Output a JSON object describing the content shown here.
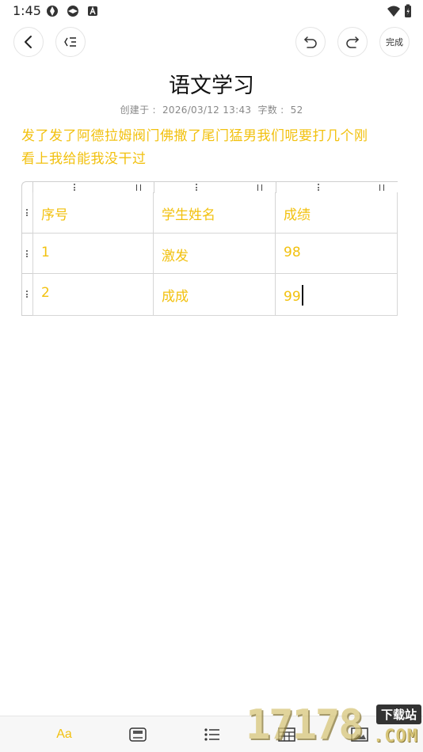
{
  "status_bar": {
    "time": "1:45"
  },
  "toolbar": {
    "done_label": "完成"
  },
  "note": {
    "title": "语文学习",
    "created_label": "创建于 :",
    "created_value": "2026/03/12 13:43",
    "word_count_label": "字数 :",
    "word_count_value": "52",
    "body_line_1": "发了发了阿德拉姆阀门佛撒了尾门猛男我们呢要打几个刚",
    "body_line_2": "看上我给能我没干过"
  },
  "table": {
    "headers": [
      "序号",
      "学生姓名",
      "成绩"
    ],
    "rows": [
      [
        "1",
        "激发",
        "98"
      ],
      [
        "2",
        "成成",
        "99"
      ]
    ]
  },
  "bottom_bar": {
    "font_label": "Aa"
  },
  "watermark": {
    "number": "17178",
    "tag": "下载站",
    "domain": ".COM"
  },
  "colors": {
    "accent_text": "#f2c10f",
    "border": "#d6d6d6"
  }
}
